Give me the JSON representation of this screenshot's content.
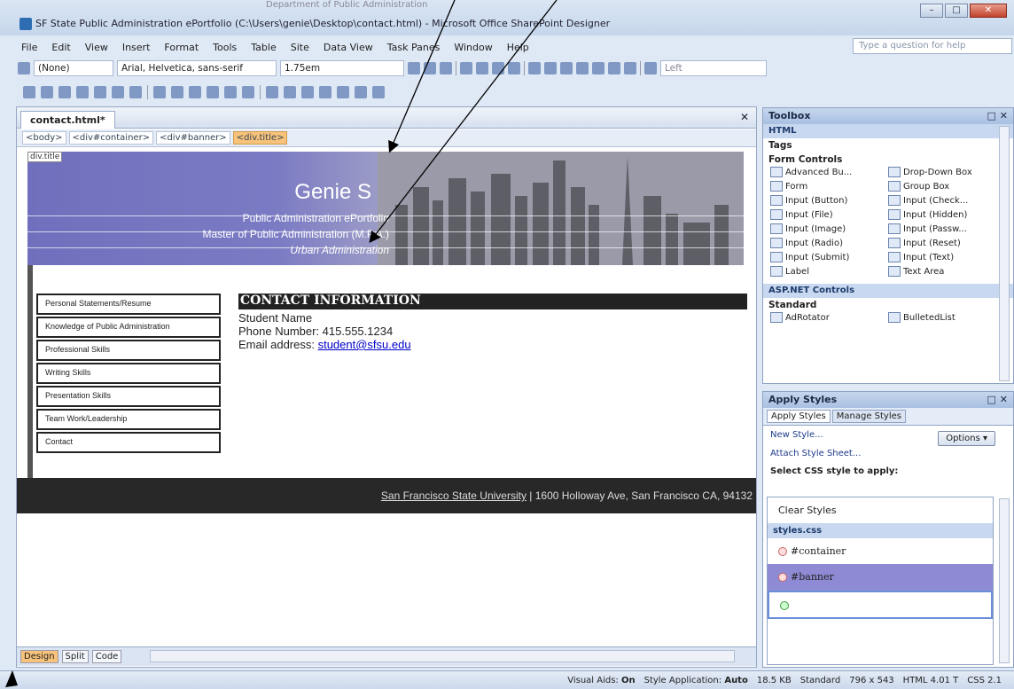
{
  "window": {
    "title": "SF State Public Administration ePortfolio (C:\\Users\\genie\\Desktop\\contact.html) - Microsoft Office SharePoint Designer",
    "min": "–",
    "max": "□",
    "close": "✕",
    "behind_text": "Department of Public Administration"
  },
  "menu": {
    "items": [
      "File",
      "Edit",
      "View",
      "Insert",
      "Format",
      "Tools",
      "Table",
      "Site",
      "Data View",
      "Task Panes",
      "Window",
      "Help"
    ],
    "help_placeholder": "Type a question for help"
  },
  "formatting": {
    "style": "(None)",
    "font": "Arial, Helvetica, sans-serif",
    "size": "1.75em",
    "position": "Left"
  },
  "editor": {
    "tab": "contact.html*",
    "close": "✕",
    "crumbs": [
      "<body>",
      "<div#container>",
      "<div#banner>",
      "<div.title>"
    ],
    "div_label": "div.title",
    "banner": {
      "name": "Genie S",
      "line1": "Public Administration ePortfolio",
      "line2": "Master of Public Administration (M.P.A.)",
      "line3": "Urban Administration"
    },
    "nav": [
      "Personal Statements/Resume",
      "Knowledge of Public Administration",
      "Professional Skills",
      "Writing Skills",
      "Presentation Skills",
      "Team Work/Leadership",
      "Contact"
    ],
    "contact": {
      "heading": "CONTACT INFORMATION",
      "name": "Student Name",
      "phone": "Phone Number: 415.555.1234",
      "email_label": "Email address: ",
      "email": "student@sfsu.edu"
    },
    "footer": {
      "link": "San Francisco State University",
      "rest": " | 1600 Holloway Ave, San Francisco CA, 94132"
    },
    "views": [
      "Design",
      "Split",
      "Code"
    ]
  },
  "toolbox": {
    "title": "Toolbox",
    "html": "HTML",
    "tags": "Tags",
    "form_controls": "Form Controls",
    "items": [
      "Advanced Bu...",
      "Drop-Down Box",
      "Form",
      "Group Box",
      "Input (Button)",
      "Input (Check...",
      "Input (File)",
      "Input (Hidden)",
      "Input (Image)",
      "Input (Passw...",
      "Input (Radio)",
      "Input (Reset)",
      "Input (Submit)",
      "Input (Text)",
      "Label",
      "Text Area"
    ],
    "aspnet": "ASP.NET Controls",
    "standard": "Standard",
    "std_items": [
      "AdRotator",
      "BulletedList"
    ]
  },
  "apply_styles": {
    "title": "Apply Styles",
    "tabs": [
      "Apply Styles",
      "Manage Styles"
    ],
    "new_style": "New Style...",
    "attach": "Attach Style Sheet...",
    "options": "Options ▾",
    "select_label": "Select CSS style to apply:",
    "clear": "Clear Styles",
    "sheet": "styles.css",
    "styles": [
      "#container",
      "#banner"
    ]
  },
  "status": {
    "visual_aids_label": "Visual Aids:",
    "visual_aids": "On",
    "style_app_label": "Style Application:",
    "style_app": "Auto",
    "size": "18.5 KB",
    "mode": "Standard",
    "dims": "796 x 543",
    "doctype": "HTML 4.01 T",
    "css": "CSS 2.1"
  }
}
